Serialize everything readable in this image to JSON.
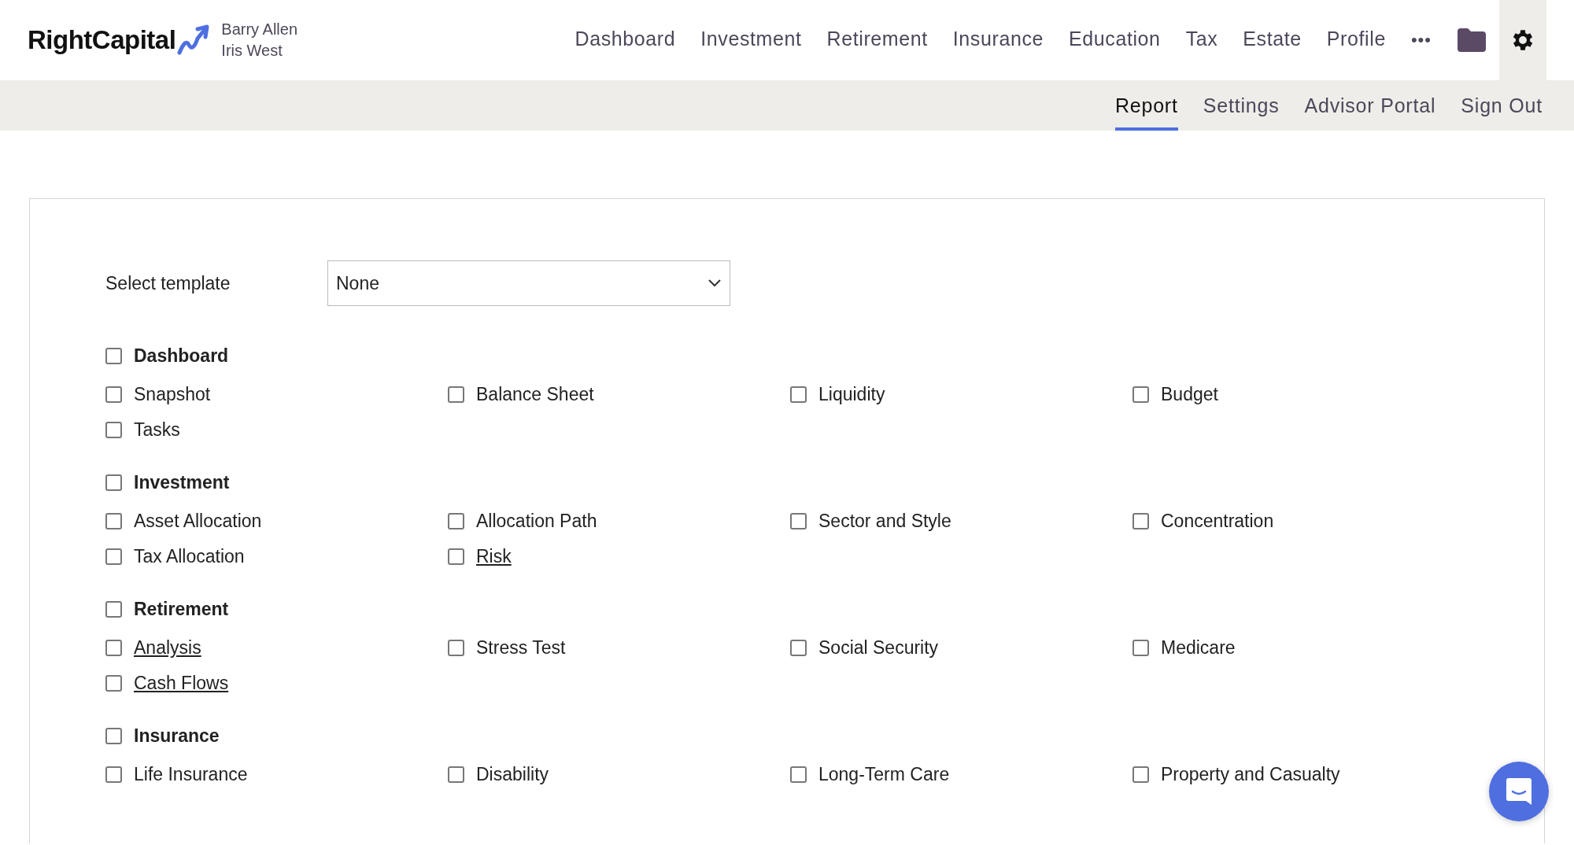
{
  "logo": {
    "text": "RightCapital"
  },
  "clients": [
    "Barry Allen",
    "Iris West"
  ],
  "nav": [
    {
      "label": "Dashboard",
      "selected": false
    },
    {
      "label": "Investment",
      "selected": false
    },
    {
      "label": "Retirement",
      "selected": false
    },
    {
      "label": "Insurance",
      "selected": false
    },
    {
      "label": "Education",
      "selected": false
    },
    {
      "label": "Tax",
      "selected": false
    },
    {
      "label": "Estate",
      "selected": false
    },
    {
      "label": "Profile",
      "selected": false
    }
  ],
  "more": "•••",
  "subnav": [
    {
      "label": "Report",
      "selected": true
    },
    {
      "label": "Settings",
      "selected": false
    },
    {
      "label": "Advisor Portal",
      "selected": false
    },
    {
      "label": "Sign Out",
      "selected": false
    }
  ],
  "template": {
    "label": "Select template",
    "value": "None"
  },
  "sections": [
    {
      "title": "Dashboard",
      "checked": false,
      "items": [
        {
          "label": "Snapshot",
          "checked": false,
          "linked": false
        },
        {
          "label": "Balance Sheet",
          "checked": false,
          "linked": false
        },
        {
          "label": "Liquidity",
          "checked": false,
          "linked": false
        },
        {
          "label": "Budget",
          "checked": false,
          "linked": false
        },
        {
          "label": "Tasks",
          "checked": false,
          "linked": false
        }
      ]
    },
    {
      "title": "Investment",
      "checked": false,
      "items": [
        {
          "label": "Asset Allocation",
          "checked": false,
          "linked": false
        },
        {
          "label": "Allocation Path",
          "checked": false,
          "linked": false
        },
        {
          "label": "Sector and Style",
          "checked": false,
          "linked": false
        },
        {
          "label": "Concentration",
          "checked": false,
          "linked": false
        },
        {
          "label": "Tax Allocation",
          "checked": false,
          "linked": false
        },
        {
          "label": "Risk",
          "checked": false,
          "linked": true
        }
      ]
    },
    {
      "title": "Retirement",
      "checked": false,
      "items": [
        {
          "label": "Analysis",
          "checked": false,
          "linked": true
        },
        {
          "label": "Stress Test",
          "checked": false,
          "linked": false
        },
        {
          "label": "Social Security",
          "checked": false,
          "linked": false
        },
        {
          "label": "Medicare",
          "checked": false,
          "linked": false
        },
        {
          "label": "Cash Flows",
          "checked": false,
          "linked": true
        }
      ]
    },
    {
      "title": "Insurance",
      "checked": false,
      "items": [
        {
          "label": "Life Insurance",
          "checked": false,
          "linked": false
        },
        {
          "label": "Disability",
          "checked": false,
          "linked": false
        },
        {
          "label": "Long-Term Care",
          "checked": false,
          "linked": false
        },
        {
          "label": "Property and Casualty",
          "checked": false,
          "linked": false
        }
      ]
    }
  ]
}
